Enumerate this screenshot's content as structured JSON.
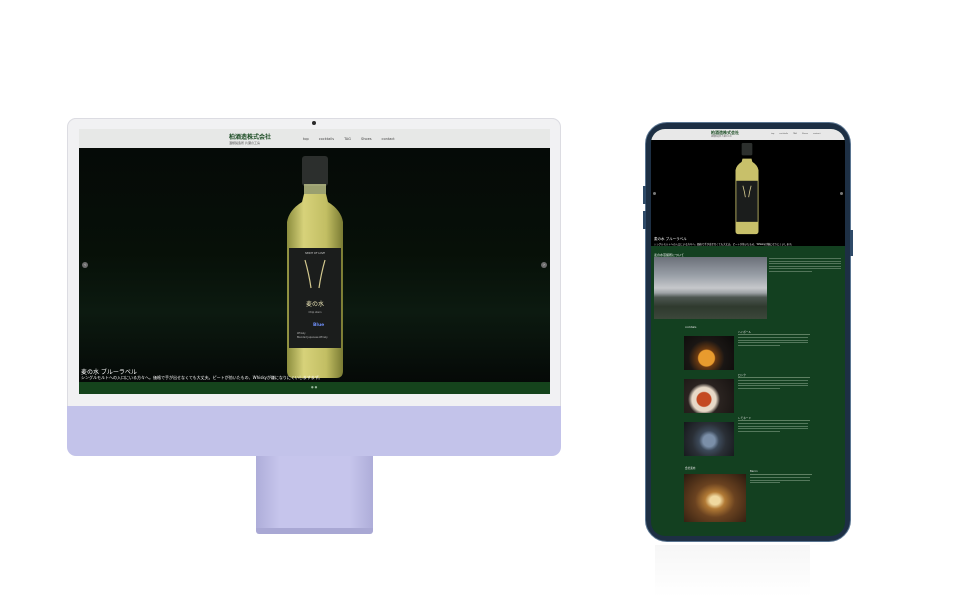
{
  "desktop": {
    "site": {
      "logo": "柏酒造株式会社",
      "subtitle": "酒類製造所 片瀬の工房",
      "nav": [
        "top",
        "cocktails",
        "TAG",
        "Shoes",
        "contact"
      ]
    },
    "hero": {
      "product_title": "麦の水 ブルーラベル",
      "product_desc": "シングルモルトへの入口にいる方々へ。価格で手が出せなくても大丈夫。ピートが効いたもの、Whiskyが嫌になりにくいしますまず。",
      "bottle": {
        "top_label": "SPIRIT OF LOVE",
        "name_jp": "麦の水",
        "name_en": "Chip stein",
        "label": "Blue",
        "details": [
          "Whisky",
          "Blended Japanese Whisky"
        ]
      },
      "prev_arrow": "‹",
      "next_arrow": "›"
    }
  },
  "mobile": {
    "site": {
      "logo": "柏酒造株式会社",
      "subtitle": "酒類製造所 片瀬の工房",
      "nav": [
        "top",
        "cocktails",
        "TAG",
        "Shoes",
        "contact"
      ]
    },
    "hero": {
      "product_title": "麦の水 ブルーラベル",
      "product_desc": "シングルモルトへの入口にいる方々へ。価格で手が出せなくても大丈夫。ピートが効いたもの、Whiskyが嫌になりにくいします。"
    },
    "section_title": "麦の水蒸留所について",
    "cocktails_heading": "cocktails",
    "cards": [
      {
        "title": "ハイボール"
      },
      {
        "title": "ロック"
      },
      {
        "title": "レモネード"
      }
    ],
    "about_heading": "会社案内",
    "about_card_title": "Baron"
  },
  "colors": {
    "site_green": "#134020",
    "imac_purple": "#c3c3ea",
    "phone_frame": "#1d2f44"
  }
}
